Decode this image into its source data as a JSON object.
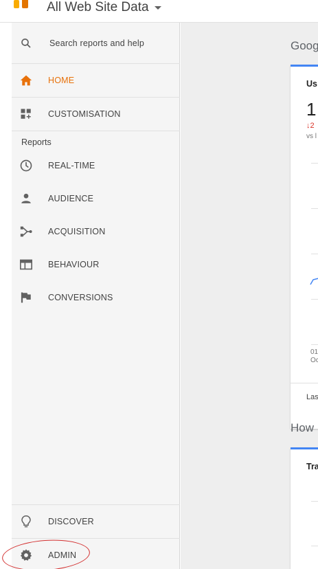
{
  "header": {
    "account_title": "All Web Site Data"
  },
  "sidebar": {
    "search_placeholder": "Search reports and help",
    "home_label": "HOME",
    "customisation_label": "CUSTOMISATION",
    "reports_heading": "Reports",
    "items": [
      {
        "label": "REAL-TIME",
        "icon": "clock-icon"
      },
      {
        "label": "AUDIENCE",
        "icon": "person-icon"
      },
      {
        "label": "ACQUISITION",
        "icon": "acquisition-icon"
      },
      {
        "label": "BEHAVIOUR",
        "icon": "behaviour-icon"
      },
      {
        "label": "CONVERSIONS",
        "icon": "flag-icon"
      }
    ],
    "discover_label": "DISCOVER",
    "admin_label": "ADMIN"
  },
  "main": {
    "heading": "Goog",
    "card1": {
      "title": "Us",
      "big_value": "1",
      "delta": "↓2",
      "vs": "vs l",
      "x_tick_line1": "01",
      "x_tick_line2": "Oc",
      "footer": "Las"
    },
    "heading2": "How",
    "card2": {
      "title": "Tra"
    }
  },
  "colors": {
    "accent_orange": "#e8710a",
    "card_top": "#4285f4",
    "annotation_red": "#d32f2f"
  }
}
